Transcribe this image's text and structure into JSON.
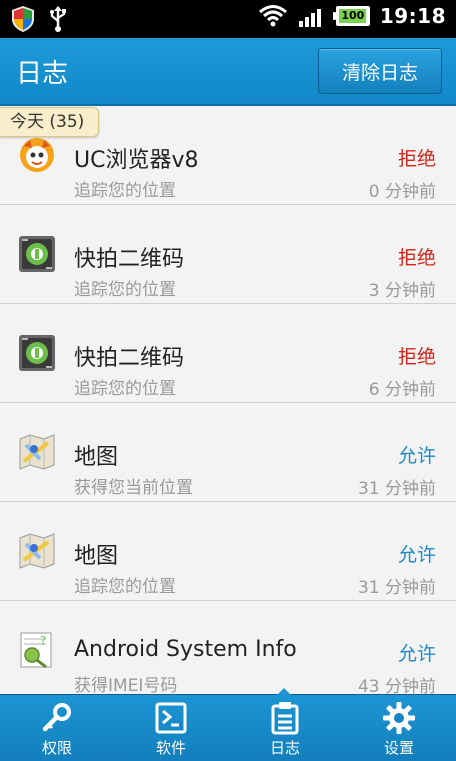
{
  "status_bar": {
    "time": "19:18",
    "battery": "100"
  },
  "header": {
    "title": "日志",
    "clear_button": "清除日志"
  },
  "section": {
    "label": "今天 (35)"
  },
  "log_items": [
    {
      "app": "UC浏览器v8",
      "detail": "追踪您的位置",
      "action": "拒绝",
      "time": "0 分钟前",
      "icon": "uc-browser-icon"
    },
    {
      "app": "快拍二维码",
      "detail": "追踪您的位置",
      "action": "拒绝",
      "time": "3 分钟前",
      "icon": "qr-scanner-icon"
    },
    {
      "app": "快拍二维码",
      "detail": "追踪您的位置",
      "action": "拒绝",
      "time": "6 分钟前",
      "icon": "qr-scanner-icon"
    },
    {
      "app": "地图",
      "detail": "获得您当前位置",
      "action": "允许",
      "time": "31 分钟前",
      "icon": "maps-icon"
    },
    {
      "app": "地图",
      "detail": "追踪您的位置",
      "action": "允许",
      "time": "31 分钟前",
      "icon": "maps-icon"
    },
    {
      "app": "Android System Info",
      "detail": "获得IMEI号码",
      "action": "允许",
      "time": "43 分钟前",
      "icon": "system-info-icon"
    }
  ],
  "tabs": [
    {
      "label": "权限",
      "icon": "key-icon"
    },
    {
      "label": "软件",
      "icon": "terminal-icon"
    },
    {
      "label": "日志",
      "icon": "log-icon",
      "selected": true
    },
    {
      "label": "设置",
      "icon": "gear-icon"
    }
  ],
  "colors": {
    "accent": "#1288c8",
    "deny": "#d0241a",
    "allow": "#1d8bc9"
  }
}
